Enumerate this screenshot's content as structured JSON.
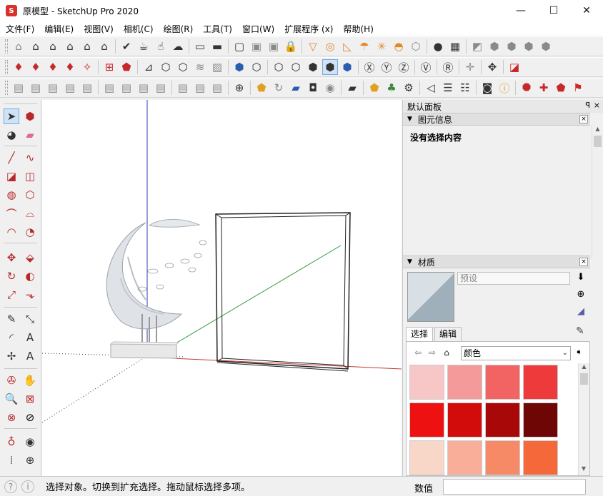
{
  "window": {
    "title": "原模型 - SketchUp Pro 2020",
    "app_icon_glyph": "S",
    "minimize_glyph": "—",
    "maximize_glyph": "☐",
    "close_glyph": "✕"
  },
  "menu": [
    "文件(F)",
    "编辑(E)",
    "视图(V)",
    "相机(C)",
    "绘图(R)",
    "工具(T)",
    "窗口(W)",
    "扩展程序 (x)",
    "帮助(H)"
  ],
  "tray": {
    "title": "默认面板",
    "pin_glyph": "ꟼ",
    "close_glyph": "×",
    "entity_info": {
      "title": "图元信息",
      "message": "没有选择内容"
    },
    "materials": {
      "title": "材质",
      "name_placeholder": "预设",
      "tabs": [
        "选择",
        "编辑"
      ],
      "category": "颜色",
      "swatch_colors": [
        "#f7c6c6",
        "#f59a9a",
        "#f26464",
        "#ee3a3a",
        "#ee1111",
        "#d20b0b",
        "#a80808",
        "#6e0606",
        "#f9d7c8",
        "#f8ae98",
        "#f78a66",
        "#f5683a",
        "#e06a2a",
        "#d85a20",
        "#c65a1c",
        "#b04c10"
      ]
    }
  },
  "status": {
    "text": "选择对象。切换到扩充选择。拖动鼠标选择多项。",
    "measure_label": "数值",
    "measure_value": ""
  },
  "colors": {
    "axis_red": "#c0392b",
    "axis_green": "#2e9b3a",
    "axis_blue": "#2a3db0"
  }
}
